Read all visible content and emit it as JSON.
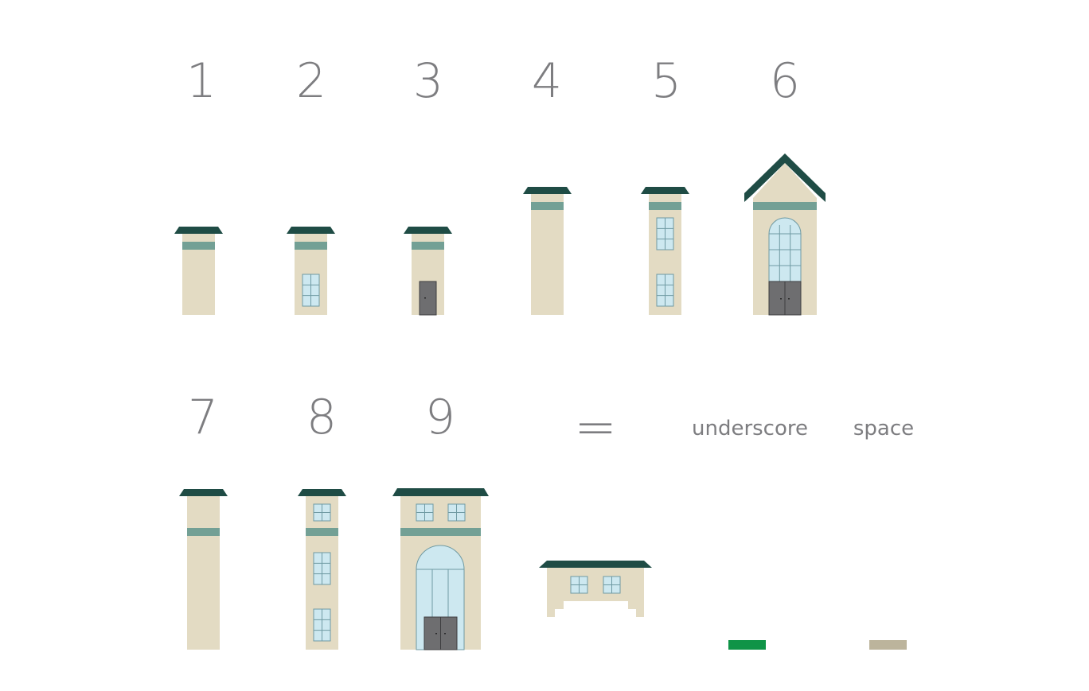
{
  "colors": {
    "wall": "#e3dbc3",
    "roof": "#1f4c45",
    "band": "#73a095",
    "glass": "#cde8f0",
    "window_frame": "#6f9aa3",
    "door": "#6e6e70",
    "label": "#7d7d80",
    "underscore_swatch": "#0f9447",
    "space_swatch": "#bcb49c"
  },
  "glyphs": [
    {
      "label": "1",
      "icon": "plain-tower"
    },
    {
      "label": "2",
      "icon": "tower-with-window"
    },
    {
      "label": "3",
      "icon": "tower-with-door"
    },
    {
      "label": "4",
      "icon": "tall-plain-tower"
    },
    {
      "label": "5",
      "icon": "tall-tower-two-windows"
    },
    {
      "label": "6",
      "icon": "gabled-tower-arched-window-double-door"
    },
    {
      "label": "7",
      "icon": "tallest-plain-tower"
    },
    {
      "label": "8",
      "icon": "tallest-tower-three-windows"
    },
    {
      "label": "9",
      "icon": "wide-tower-arched-entrance"
    },
    {
      "label": "=",
      "icon": "low-pavilion"
    },
    {
      "label": "underscore",
      "icon": "green-bar"
    },
    {
      "label": "space",
      "icon": "beige-bar"
    }
  ]
}
